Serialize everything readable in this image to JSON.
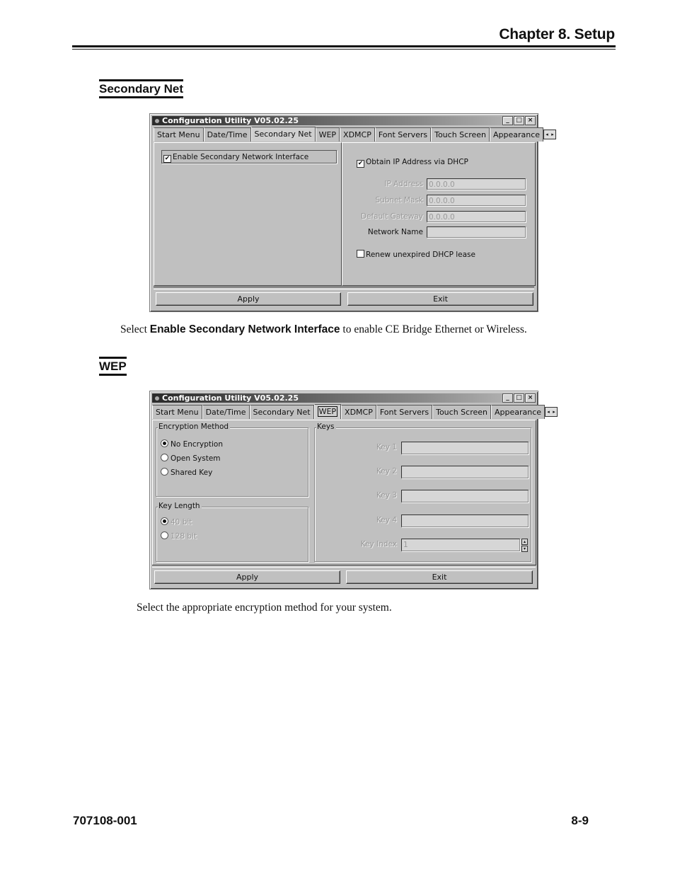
{
  "page": {
    "chapter_title": "Chapter 8.  Setup",
    "footer_doc_number": "707108-001",
    "footer_page_number": "8-9"
  },
  "sections": {
    "secondary_net": {
      "heading": "Secondary Net",
      "caption_prefix": "Select ",
      "caption_bold": "Enable Secondary Network Interface",
      "caption_suffix": " to enable CE Bridge Ethernet or Wireless."
    },
    "wep": {
      "heading": "WEP",
      "caption": "Select the appropriate encryption method for your system."
    }
  },
  "window_common": {
    "title": "Configuration Utility V05.02.25",
    "minimize_glyph": "_",
    "maximize_glyph": "□",
    "close_glyph": "×",
    "tab_scroll_left": "◂",
    "tab_scroll_right": "▸",
    "tabs": [
      "Start Menu",
      "Date/Time",
      "Secondary Net",
      "WEP",
      "XDMCP",
      "Font Servers",
      "Touch Screen",
      "Appearance"
    ],
    "apply_label": "Apply",
    "exit_label": "Exit"
  },
  "window1": {
    "active_tab": "Secondary Net",
    "enable_secondary": {
      "label": "Enable Secondary Network Interface",
      "checked": true
    },
    "obtain_dhcp": {
      "label": "Obtain IP Address via DHCP",
      "checked": true
    },
    "fields": [
      {
        "label": "IP Address",
        "value": "0.0.0.0",
        "enabled": false
      },
      {
        "label": "Subnet Mask",
        "value": "0.0.0.0",
        "enabled": false
      },
      {
        "label": "Default Gateway",
        "value": "0.0.0.0",
        "enabled": false
      },
      {
        "label": "Network Name",
        "value": "",
        "enabled": true
      }
    ],
    "renew_lease": {
      "label": "Renew unexpired DHCP lease",
      "checked": false
    },
    "check_glyph": "✔"
  },
  "window2": {
    "active_tab": "WEP",
    "encryption_group": {
      "title": "Encryption Method",
      "options": [
        "No Encryption",
        "Open System",
        "Shared Key"
      ],
      "selected": "No Encryption"
    },
    "key_length_group": {
      "title": "Key Length",
      "options": [
        "40 bit",
        "128 bit"
      ],
      "selected": "40 bit",
      "enabled": false
    },
    "keys_group": {
      "title": "Keys",
      "keys": [
        {
          "label": "Key 1",
          "value": ""
        },
        {
          "label": "Key 2",
          "value": ""
        },
        {
          "label": "Key 3",
          "value": ""
        },
        {
          "label": "Key 4",
          "value": ""
        }
      ],
      "key_index_label": "Key Index",
      "key_index_value": "1",
      "spin_up": "▴",
      "spin_down": "▾"
    }
  }
}
